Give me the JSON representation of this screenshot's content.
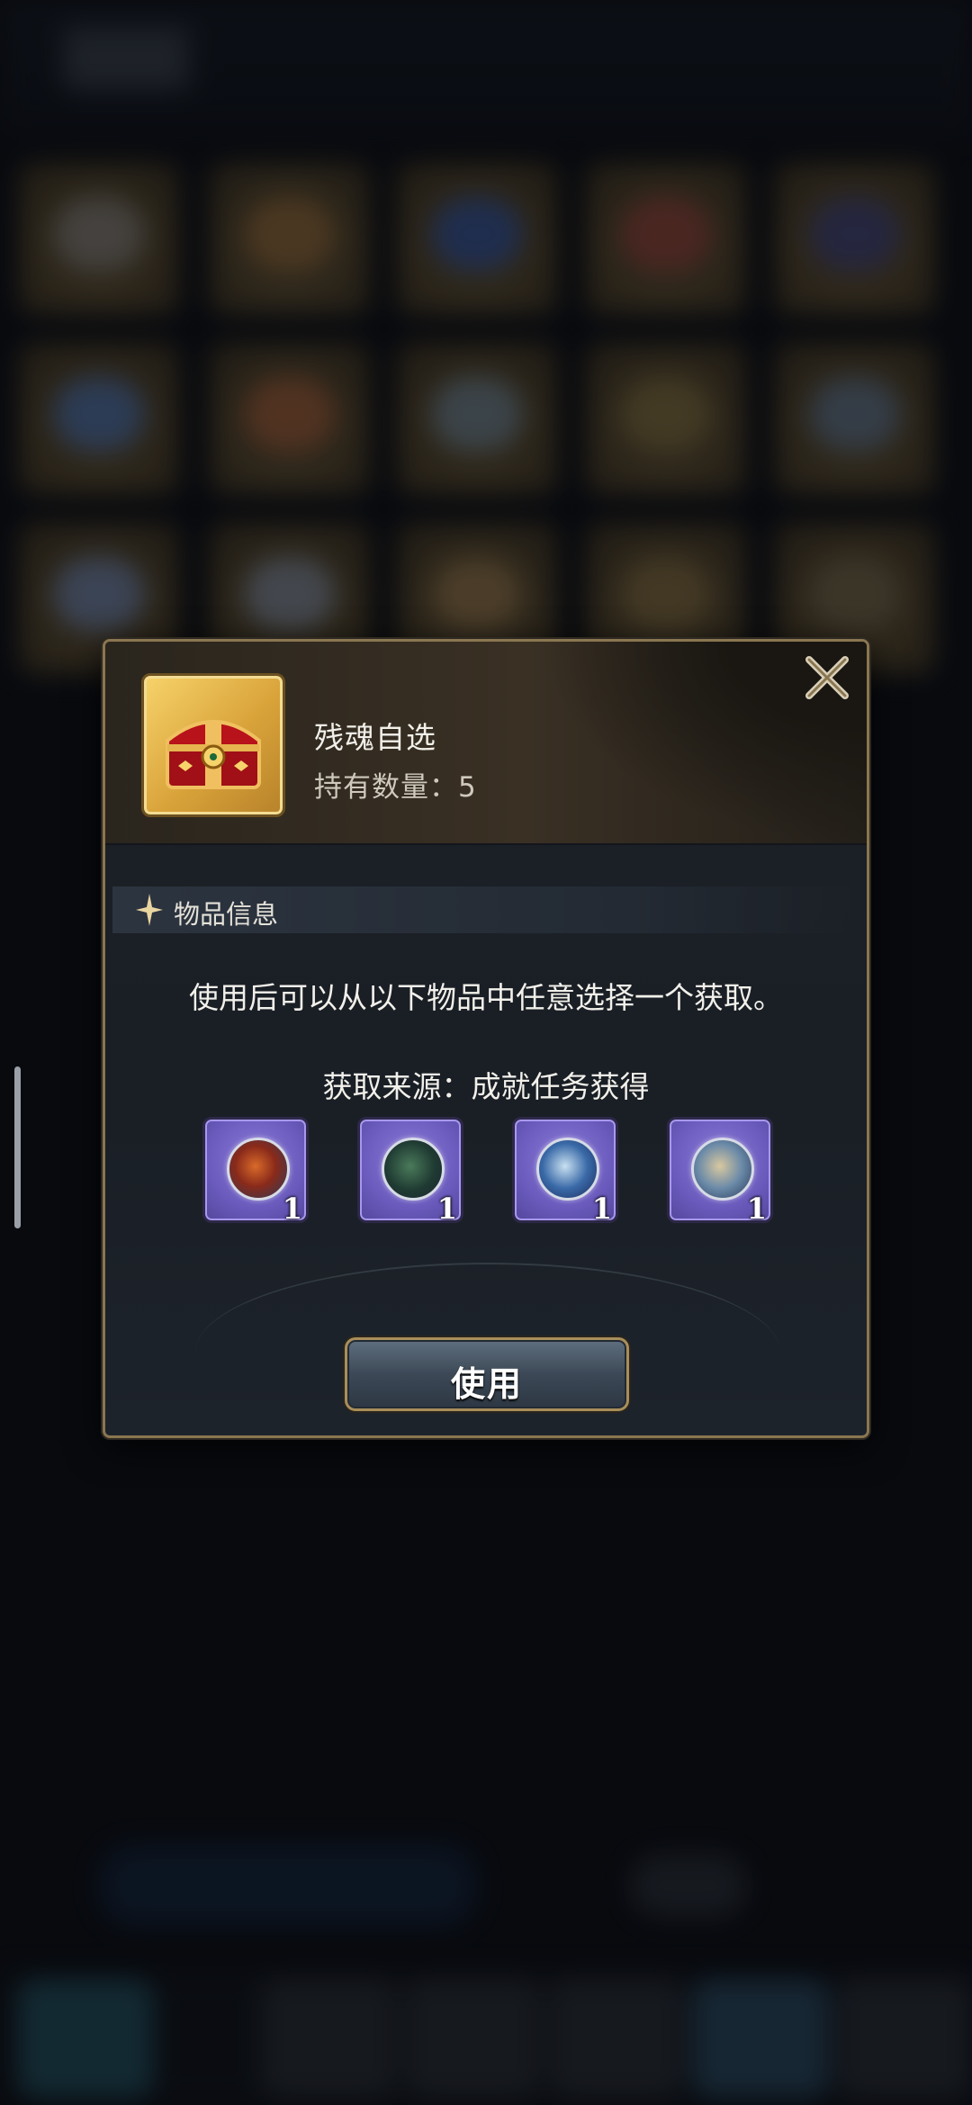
{
  "dialog": {
    "item": {
      "name": "残魂自选",
      "quantity_label": "持有数量：",
      "quantity": "5",
      "icon": "treasure-chest-icon"
    },
    "close_icon": "close-icon",
    "section": {
      "title": "物品信息",
      "icon": "sparkle-star-icon"
    },
    "description": "使用后可以从以下物品中任意选择一个获取。",
    "source_label": "获取来源：",
    "source_value": "成就任务获得",
    "rewards": [
      {
        "icon": "fire-dragon-soul-orb-icon",
        "count": "1"
      },
      {
        "icon": "dark-beast-soul-orb-icon",
        "count": "1"
      },
      {
        "icon": "ice-dragon-soul-orb-icon",
        "count": "1"
      },
      {
        "icon": "storm-spirit-soul-orb-icon",
        "count": "1"
      }
    ],
    "use_button": "使用"
  },
  "colors": {
    "frame_gold": "#8a7650",
    "reward_purple": "#6a5bbd",
    "button_steel": "#3c4856"
  }
}
